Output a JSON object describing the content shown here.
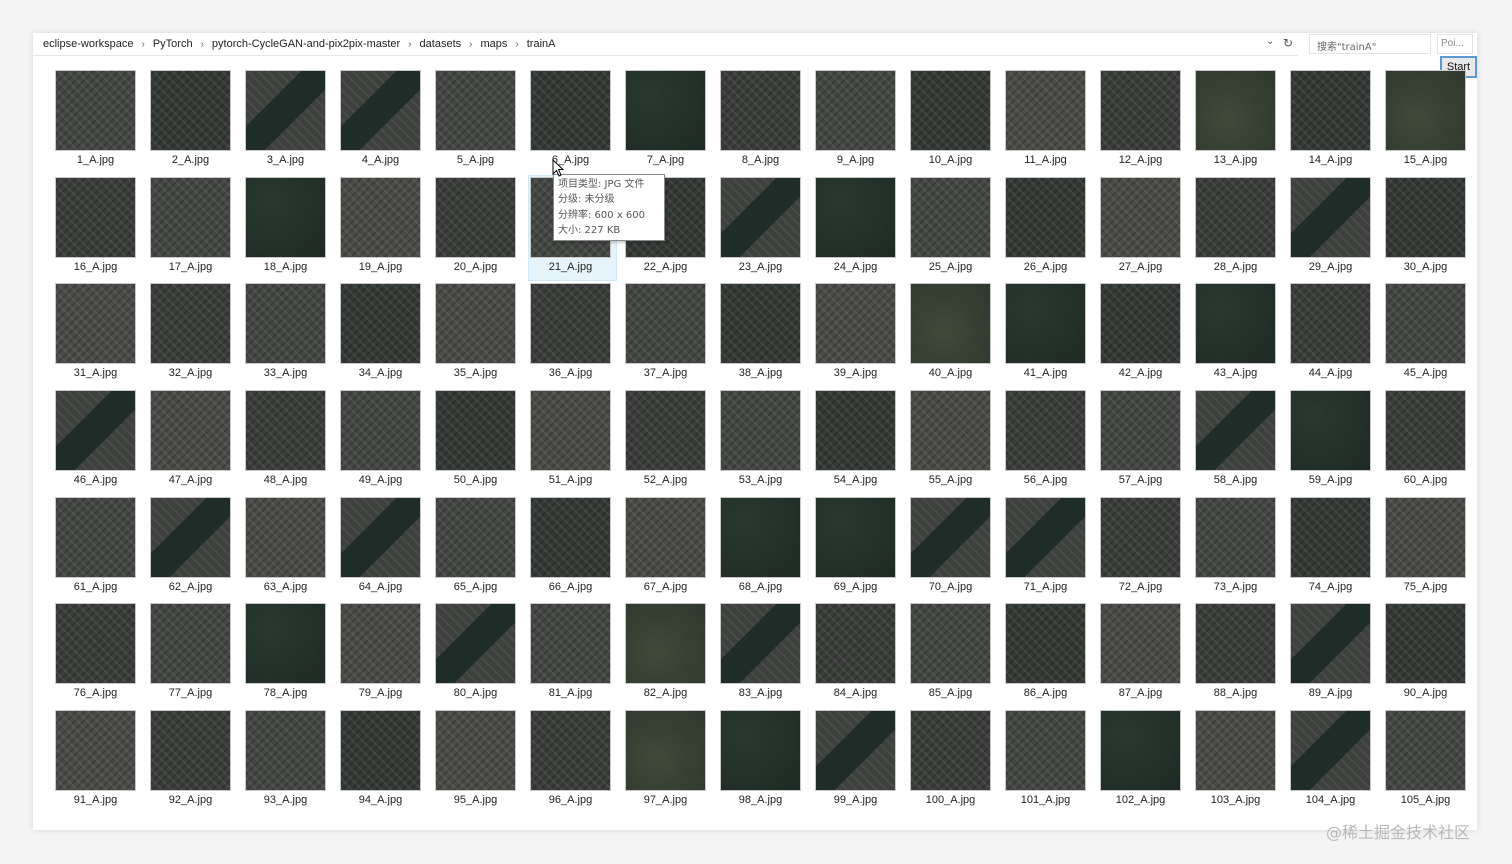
{
  "breadcrumb": [
    "eclipse-workspace",
    "PyTorch",
    "pytorch-CycleGAN-and-pix2pix-master",
    "datasets",
    "maps",
    "trainA"
  ],
  "search": {
    "placeholder": "搜索\"trainA\""
  },
  "side_field": {
    "text": "Poi..."
  },
  "start_button": {
    "label": "Start"
  },
  "icons": {
    "breadcrumb_separator": "chevron-right-icon",
    "dropdown": "chevron-down-icon",
    "refresh": "refresh-icon",
    "cursor": "cursor-icon"
  },
  "tooltip": {
    "type": "项目类型: JPG 文件",
    "rating": "分级: 未分级",
    "resolution": "分辨率: 600 x 600",
    "size": "大小: 227 KB"
  },
  "hovered_file": "21_A.jpg",
  "files": [
    "1_A.jpg",
    "2_A.jpg",
    "3_A.jpg",
    "4_A.jpg",
    "5_A.jpg",
    "6_A.jpg",
    "7_A.jpg",
    "8_A.jpg",
    "9_A.jpg",
    "10_A.jpg",
    "11_A.jpg",
    "12_A.jpg",
    "13_A.jpg",
    "14_A.jpg",
    "15_A.jpg",
    "16_A.jpg",
    "17_A.jpg",
    "18_A.jpg",
    "19_A.jpg",
    "20_A.jpg",
    "21_A.jpg",
    "22_A.jpg",
    "23_A.jpg",
    "24_A.jpg",
    "25_A.jpg",
    "26_A.jpg",
    "27_A.jpg",
    "28_A.jpg",
    "29_A.jpg",
    "30_A.jpg",
    "31_A.jpg",
    "32_A.jpg",
    "33_A.jpg",
    "34_A.jpg",
    "35_A.jpg",
    "36_A.jpg",
    "37_A.jpg",
    "38_A.jpg",
    "39_A.jpg",
    "40_A.jpg",
    "41_A.jpg",
    "42_A.jpg",
    "43_A.jpg",
    "44_A.jpg",
    "45_A.jpg",
    "46_A.jpg",
    "47_A.jpg",
    "48_A.jpg",
    "49_A.jpg",
    "50_A.jpg",
    "51_A.jpg",
    "52_A.jpg",
    "53_A.jpg",
    "54_A.jpg",
    "55_A.jpg",
    "56_A.jpg",
    "57_A.jpg",
    "58_A.jpg",
    "59_A.jpg",
    "60_A.jpg",
    "61_A.jpg",
    "62_A.jpg",
    "63_A.jpg",
    "64_A.jpg",
    "65_A.jpg",
    "66_A.jpg",
    "67_A.jpg",
    "68_A.jpg",
    "69_A.jpg",
    "70_A.jpg",
    "71_A.jpg",
    "72_A.jpg",
    "73_A.jpg",
    "74_A.jpg",
    "75_A.jpg",
    "76_A.jpg",
    "77_A.jpg",
    "78_A.jpg",
    "79_A.jpg",
    "80_A.jpg",
    "81_A.jpg",
    "82_A.jpg",
    "83_A.jpg",
    "84_A.jpg",
    "85_A.jpg",
    "86_A.jpg",
    "87_A.jpg",
    "88_A.jpg",
    "89_A.jpg",
    "90_A.jpg",
    "91_A.jpg",
    "92_A.jpg",
    "93_A.jpg",
    "94_A.jpg",
    "95_A.jpg",
    "96_A.jpg",
    "97_A.jpg",
    "98_A.jpg",
    "99_A.jpg",
    "100_A.jpg",
    "101_A.jpg",
    "102_A.jpg",
    "103_A.jpg",
    "104_A.jpg",
    "105_A.jpg"
  ],
  "watermark": "@稀土掘金技术社区"
}
